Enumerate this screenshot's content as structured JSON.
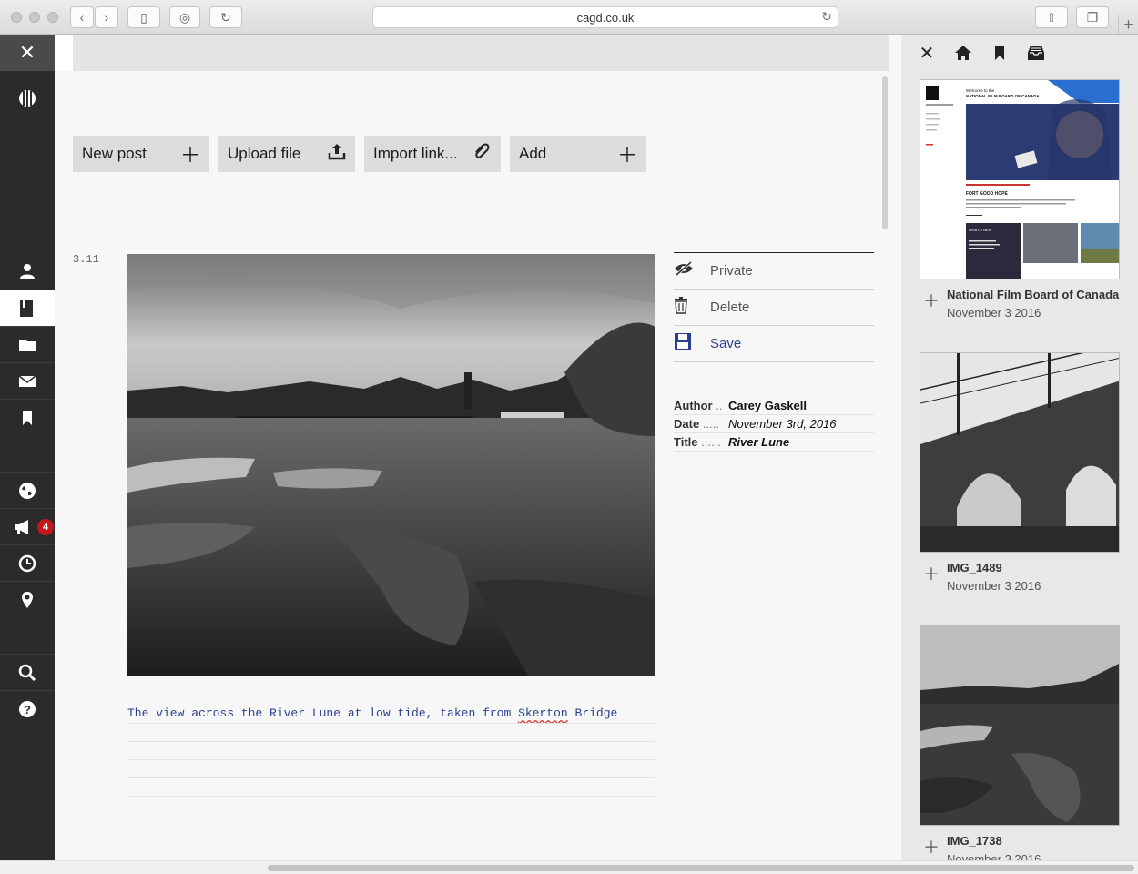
{
  "browser": {
    "url": "cagd.co.uk"
  },
  "sidebar": {
    "notification_count": "4"
  },
  "toolbar": {
    "buttons": [
      {
        "label": "New post",
        "icon": "+"
      },
      {
        "label": "Upload file",
        "icon": "upload"
      },
      {
        "label": "Import link...",
        "icon": "paperclip"
      },
      {
        "label": "Add",
        "icon": "+"
      }
    ]
  },
  "post": {
    "number": "3.11",
    "caption_before": "The view across the River Lune at low tide, taken from ",
    "caption_misspelled": "Skerton",
    "caption_after": " Bridge",
    "actions": {
      "private": "Private",
      "delete": "Delete",
      "save": "Save"
    },
    "meta": {
      "author_key": "Author",
      "author_dots": "..",
      "author": "Carey Gaskell",
      "date_key": "Date",
      "date_dots": ".....",
      "date": "November 3rd, 2016",
      "title_key": "Title",
      "title_dots": "......",
      "title": "River Lune"
    }
  },
  "library": {
    "items": [
      {
        "title": "National Film Board of Canada",
        "date": "November 3 2016"
      },
      {
        "title": "IMG_1489",
        "date": "November 3 2016"
      },
      {
        "title": "IMG_1738",
        "date": "November 3 2016"
      }
    ]
  },
  "nfb_thumb": {
    "welcome": "Welcome to the",
    "org": "NATIONAL FILM BOARD OF CANADA",
    "headline": "FORT GOOD HOPE",
    "section": "WHAT'S NEW"
  },
  "colors": {
    "accent": "#2c3f8f",
    "sidebar": "#2b2b2b",
    "badge": "#c4161c"
  }
}
